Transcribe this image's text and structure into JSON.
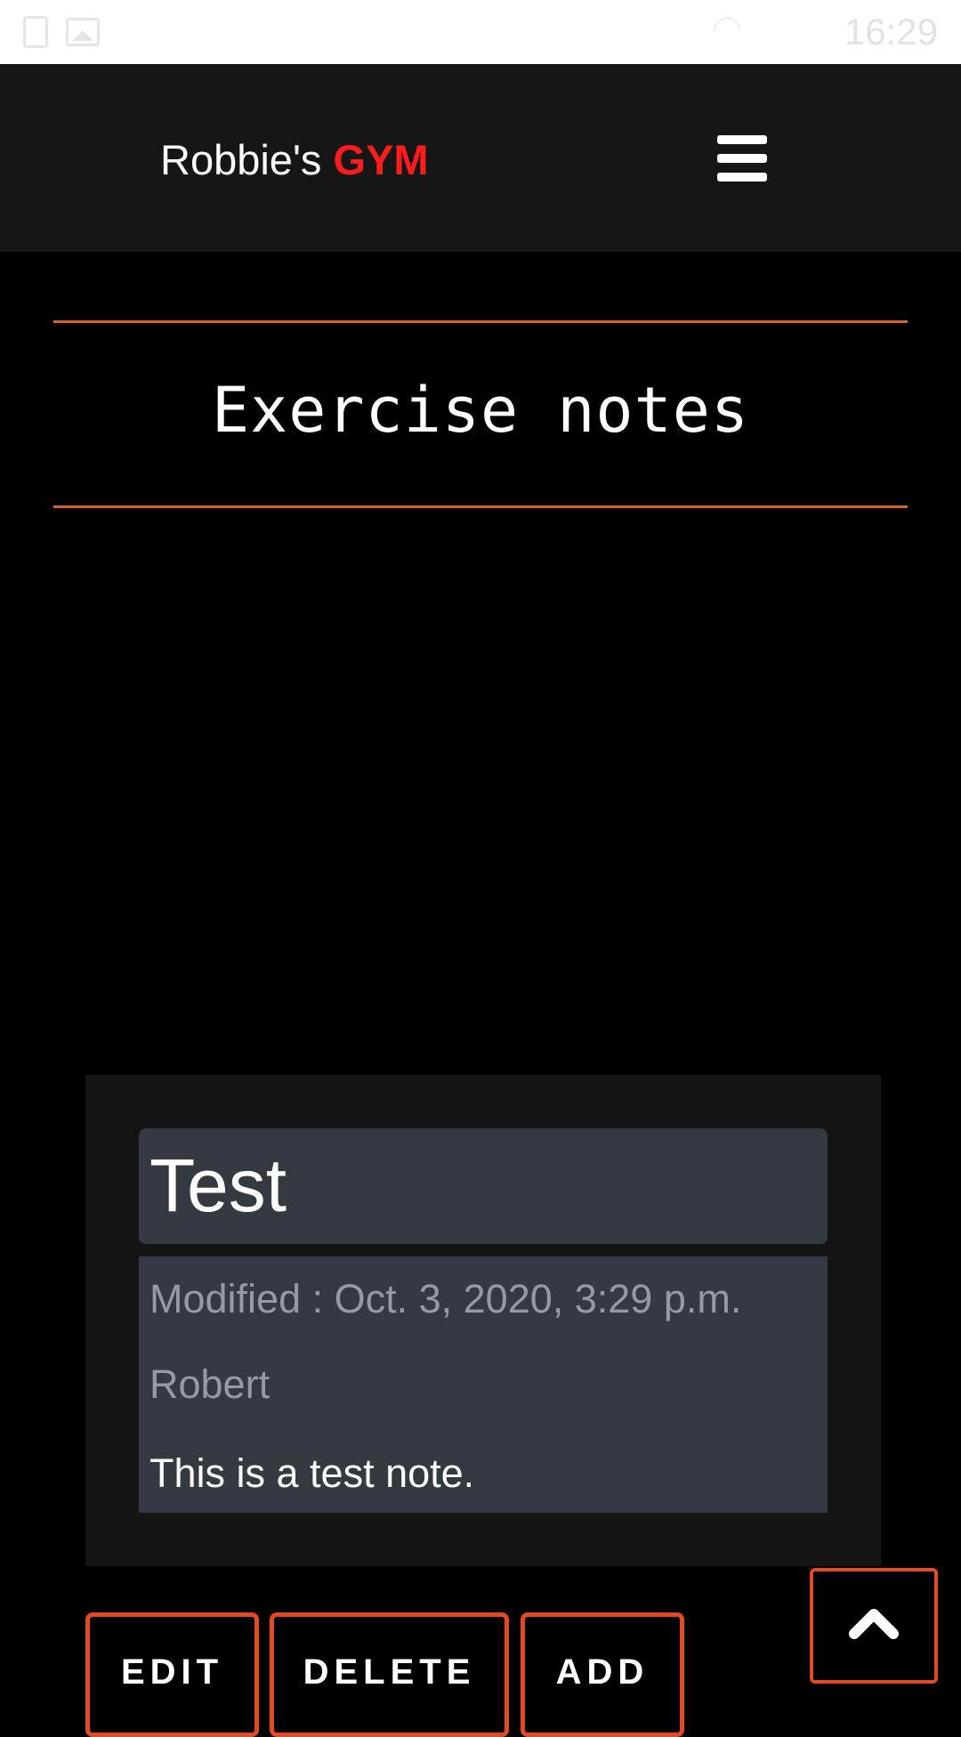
{
  "status_bar": {
    "time": "16:29",
    "icons": [
      "sim-icon",
      "image-icon",
      "wifi-icon"
    ]
  },
  "header": {
    "brand_prefix": "Robbie's",
    "brand_accent": "GYM",
    "accent_color": "#ff1c1c",
    "menu_icon": "hamburger-menu-icon"
  },
  "main": {
    "page_title": "Exercise notes",
    "divider_color": "#d4622a"
  },
  "note": {
    "title": "Test",
    "modified": "Modified : Oct. 3, 2020, 3:29 p.m.",
    "author": "Robert",
    "body": "This is a test note."
  },
  "actions": {
    "edit_label": "EDIT",
    "delete_label": "DELETE",
    "add_label": "ADD",
    "border_color": "#e14a22",
    "scroll_top_icon": "chevron-up-icon"
  }
}
